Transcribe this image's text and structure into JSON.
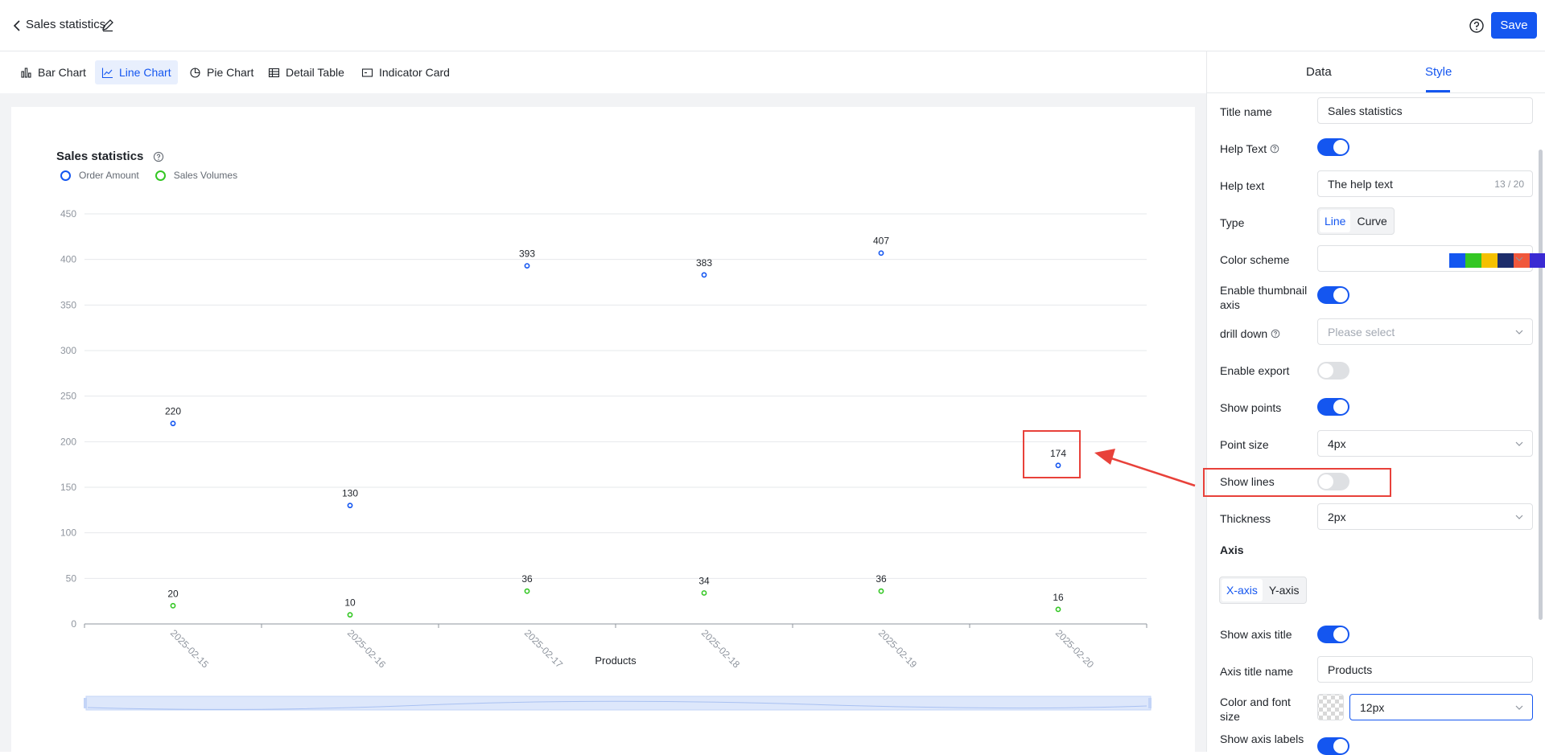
{
  "header": {
    "title": "Sales statistics",
    "save_label": "Save"
  },
  "chart_types": [
    {
      "label": "Bar Chart",
      "icon": "bar-chart-icon"
    },
    {
      "label": "Line Chart",
      "icon": "line-chart-icon",
      "active": true
    },
    {
      "label": "Pie Chart",
      "icon": "pie-chart-icon"
    },
    {
      "label": "Detail Table",
      "icon": "table-icon"
    },
    {
      "label": "Indicator Card",
      "icon": "card-icon"
    }
  ],
  "chart_data": {
    "type": "scatter",
    "title": "Sales statistics",
    "xlabel": "Products",
    "ylabel": "",
    "categories": [
      "2025-02-15",
      "2025-02-16",
      "2025-02-17",
      "2025-02-18",
      "2025-02-19",
      "2025-02-20"
    ],
    "ylim": [
      0,
      450
    ],
    "yticks": [
      0,
      50,
      100,
      150,
      200,
      250,
      300,
      350,
      400,
      450
    ],
    "grid": true,
    "legend": "top-left",
    "series": [
      {
        "name": "Order Amount",
        "color": "#1456f0",
        "values": [
          220,
          130,
          393,
          383,
          407,
          174
        ]
      },
      {
        "name": "Sales Volumes",
        "color": "#34c724",
        "values": [
          20,
          10,
          36,
          34,
          36,
          16
        ]
      }
    ]
  },
  "panel": {
    "tabs": [
      "Data",
      "Style"
    ],
    "active_tab": "Style",
    "title_name_label": "Title name",
    "title_name_value": "Sales statistics",
    "help_text_toggle_label": "Help Text",
    "help_text_label": "Help text",
    "help_text_value": "The help text",
    "help_text_count": "13 / 20",
    "type_label": "Type",
    "type_options": [
      "Line",
      "Curve"
    ],
    "color_scheme_label": "Color scheme",
    "color_scheme": [
      "#1456f0",
      "#34c724",
      "#f5c000",
      "#1d2d6b",
      "#f0573c",
      "#3a2ad3",
      "#20b2aa",
      "#7b4fe8",
      "#4aa8e8",
      "#e8344e"
    ],
    "thumbnail_axis_label": "Enable thumbnail axis",
    "drill_down_label": "drill down",
    "drill_down_placeholder": "Please select",
    "export_label": "Enable export",
    "show_points_label": "Show points",
    "point_size_label": "Point size",
    "point_size_value": "4px",
    "show_lines_label": "Show lines",
    "thickness_label": "Thickness",
    "thickness_value": "2px",
    "axis_section": "Axis",
    "axis_options": [
      "X-axis",
      "Y-axis"
    ],
    "show_axis_title_label": "Show axis title",
    "axis_title_name_label": "Axis title name",
    "axis_title_name_value": "Products",
    "color_font_label": "Color and font size",
    "font_size_value": "12px",
    "show_axis_labels_label": "Show axis labels"
  },
  "toggles": {
    "help_text": true,
    "thumbnail_axis": true,
    "export": false,
    "show_points": true,
    "show_lines": false,
    "show_axis_title": true,
    "show_axis_labels": true
  }
}
